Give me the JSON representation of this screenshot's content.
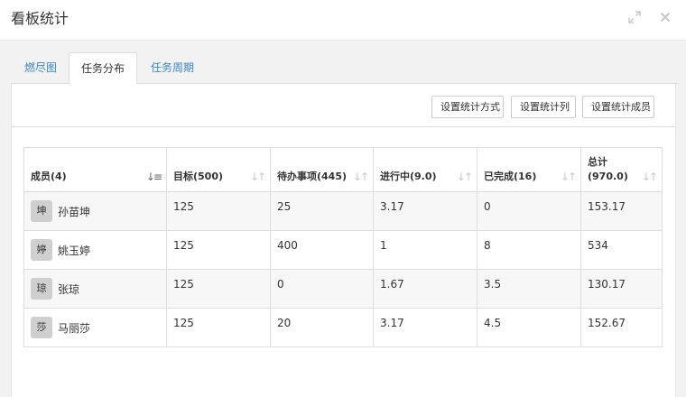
{
  "dialog": {
    "title": "看板统计"
  },
  "tabs": [
    {
      "label": "燃尽图"
    },
    {
      "label": "任务分布"
    },
    {
      "label": "任务周期"
    }
  ],
  "toolbar": {
    "buttons": [
      {
        "label": "设置统计方式"
      },
      {
        "label": "设置统计列"
      },
      {
        "label": "设置统计成员"
      }
    ]
  },
  "table": {
    "columns": [
      {
        "label": "成员(4)"
      },
      {
        "label": "目标(500)"
      },
      {
        "label": "待办事项(445)"
      },
      {
        "label": "进行中(9.0)"
      },
      {
        "label": "已完成(16)"
      },
      {
        "label_line1": "总计",
        "label_line2": "(970.0)"
      }
    ],
    "rows": [
      {
        "avatar": "坤",
        "name": "孙苗坤",
        "cells": [
          "125",
          "25",
          "3.17",
          "0",
          "153.17"
        ]
      },
      {
        "avatar": "婷",
        "name": "姚玉婷",
        "cells": [
          "125",
          "400",
          "1",
          "8",
          "534"
        ]
      },
      {
        "avatar": "琼",
        "name": "张琼",
        "cells": [
          "125",
          "0",
          "1.67",
          "3.5",
          "130.17"
        ]
      },
      {
        "avatar": "莎",
        "name": "马丽莎",
        "cells": [
          "125",
          "20",
          "3.17",
          "4.5",
          "152.67"
        ]
      }
    ]
  }
}
